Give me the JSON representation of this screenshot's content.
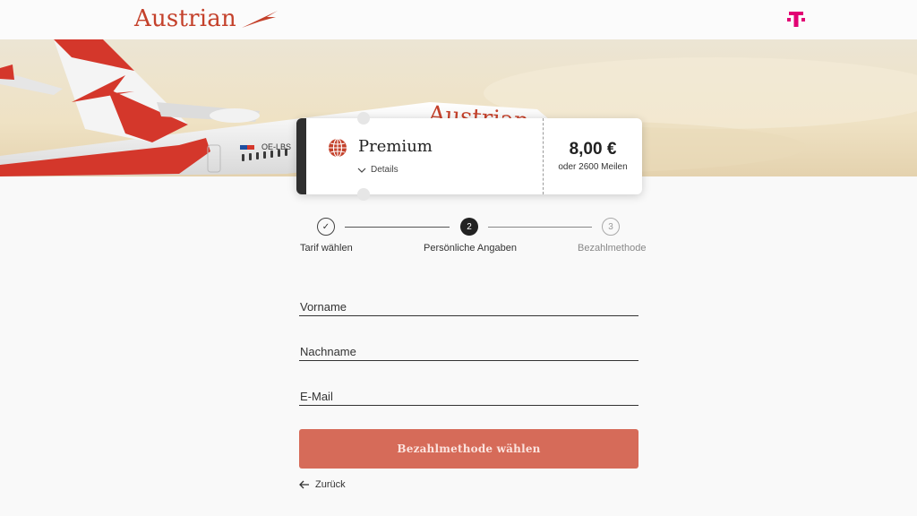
{
  "header": {
    "logo_text": "Austrian",
    "brand_color": "#c4412b",
    "partner_logo": "T",
    "partner_color": "#e20074"
  },
  "hero": {
    "aircraft_lettering": "Austrian",
    "registration": "OE-LBS"
  },
  "ticket": {
    "tariff_name": "Premium",
    "details_label": "Details",
    "price": "8,00 €",
    "miles_text": "oder 2600 Meilen",
    "icon": "globe-icon"
  },
  "stepper": {
    "steps": [
      {
        "label": "Tarif wählen",
        "state": "done",
        "marker": "✓"
      },
      {
        "label": "Persönliche Angaben",
        "state": "active",
        "marker": "2"
      },
      {
        "label": "Bezahlmethode",
        "state": "upcoming",
        "marker": "3"
      }
    ]
  },
  "form": {
    "first_name_placeholder": "Vorname",
    "last_name_placeholder": "Nachname",
    "email_placeholder": "E-Mail",
    "submit_label": "Bezahlmethode wählen",
    "back_label": "Zurück",
    "accent_color": "#d66b59"
  }
}
